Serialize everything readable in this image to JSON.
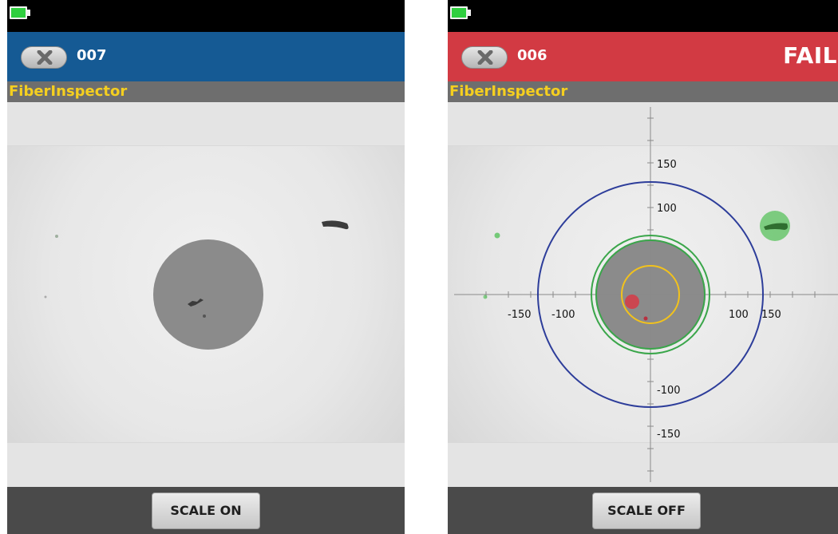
{
  "colors": {
    "status_bar": "#000000",
    "battery": "#2fcf3f",
    "title_pass_blue": "#155a94",
    "title_fail_red": "#d23a43",
    "app_name_yellow": "#f5cf1f",
    "cladding_ring_blue": "#2d3d9a",
    "fiber_ring_green": "#3aa64a",
    "core_ring_yellow": "#f2c21c",
    "defect_red": "#d63a45",
    "defect_green": "#58c25c"
  },
  "screens": [
    {
      "battery_icon": "battery-full-icon",
      "close_icon": "close-x-icon",
      "test_id": "007",
      "app_name": "FiberInspector",
      "scale_button_label": "SCALE ON"
    },
    {
      "battery_icon": "battery-full-icon",
      "close_icon": "close-x-icon",
      "test_id": "006",
      "result": "FAIL",
      "app_name": "FiberInspector",
      "scale_button_label": "SCALE OFF",
      "scale_labels": {
        "x_neg_150": "-150",
        "x_neg_100": "-100",
        "x_100": "100",
        "x_150": "150",
        "y_150": "150",
        "y_100": "100",
        "y_neg_100": "-100",
        "y_neg_150": "-150"
      }
    }
  ]
}
